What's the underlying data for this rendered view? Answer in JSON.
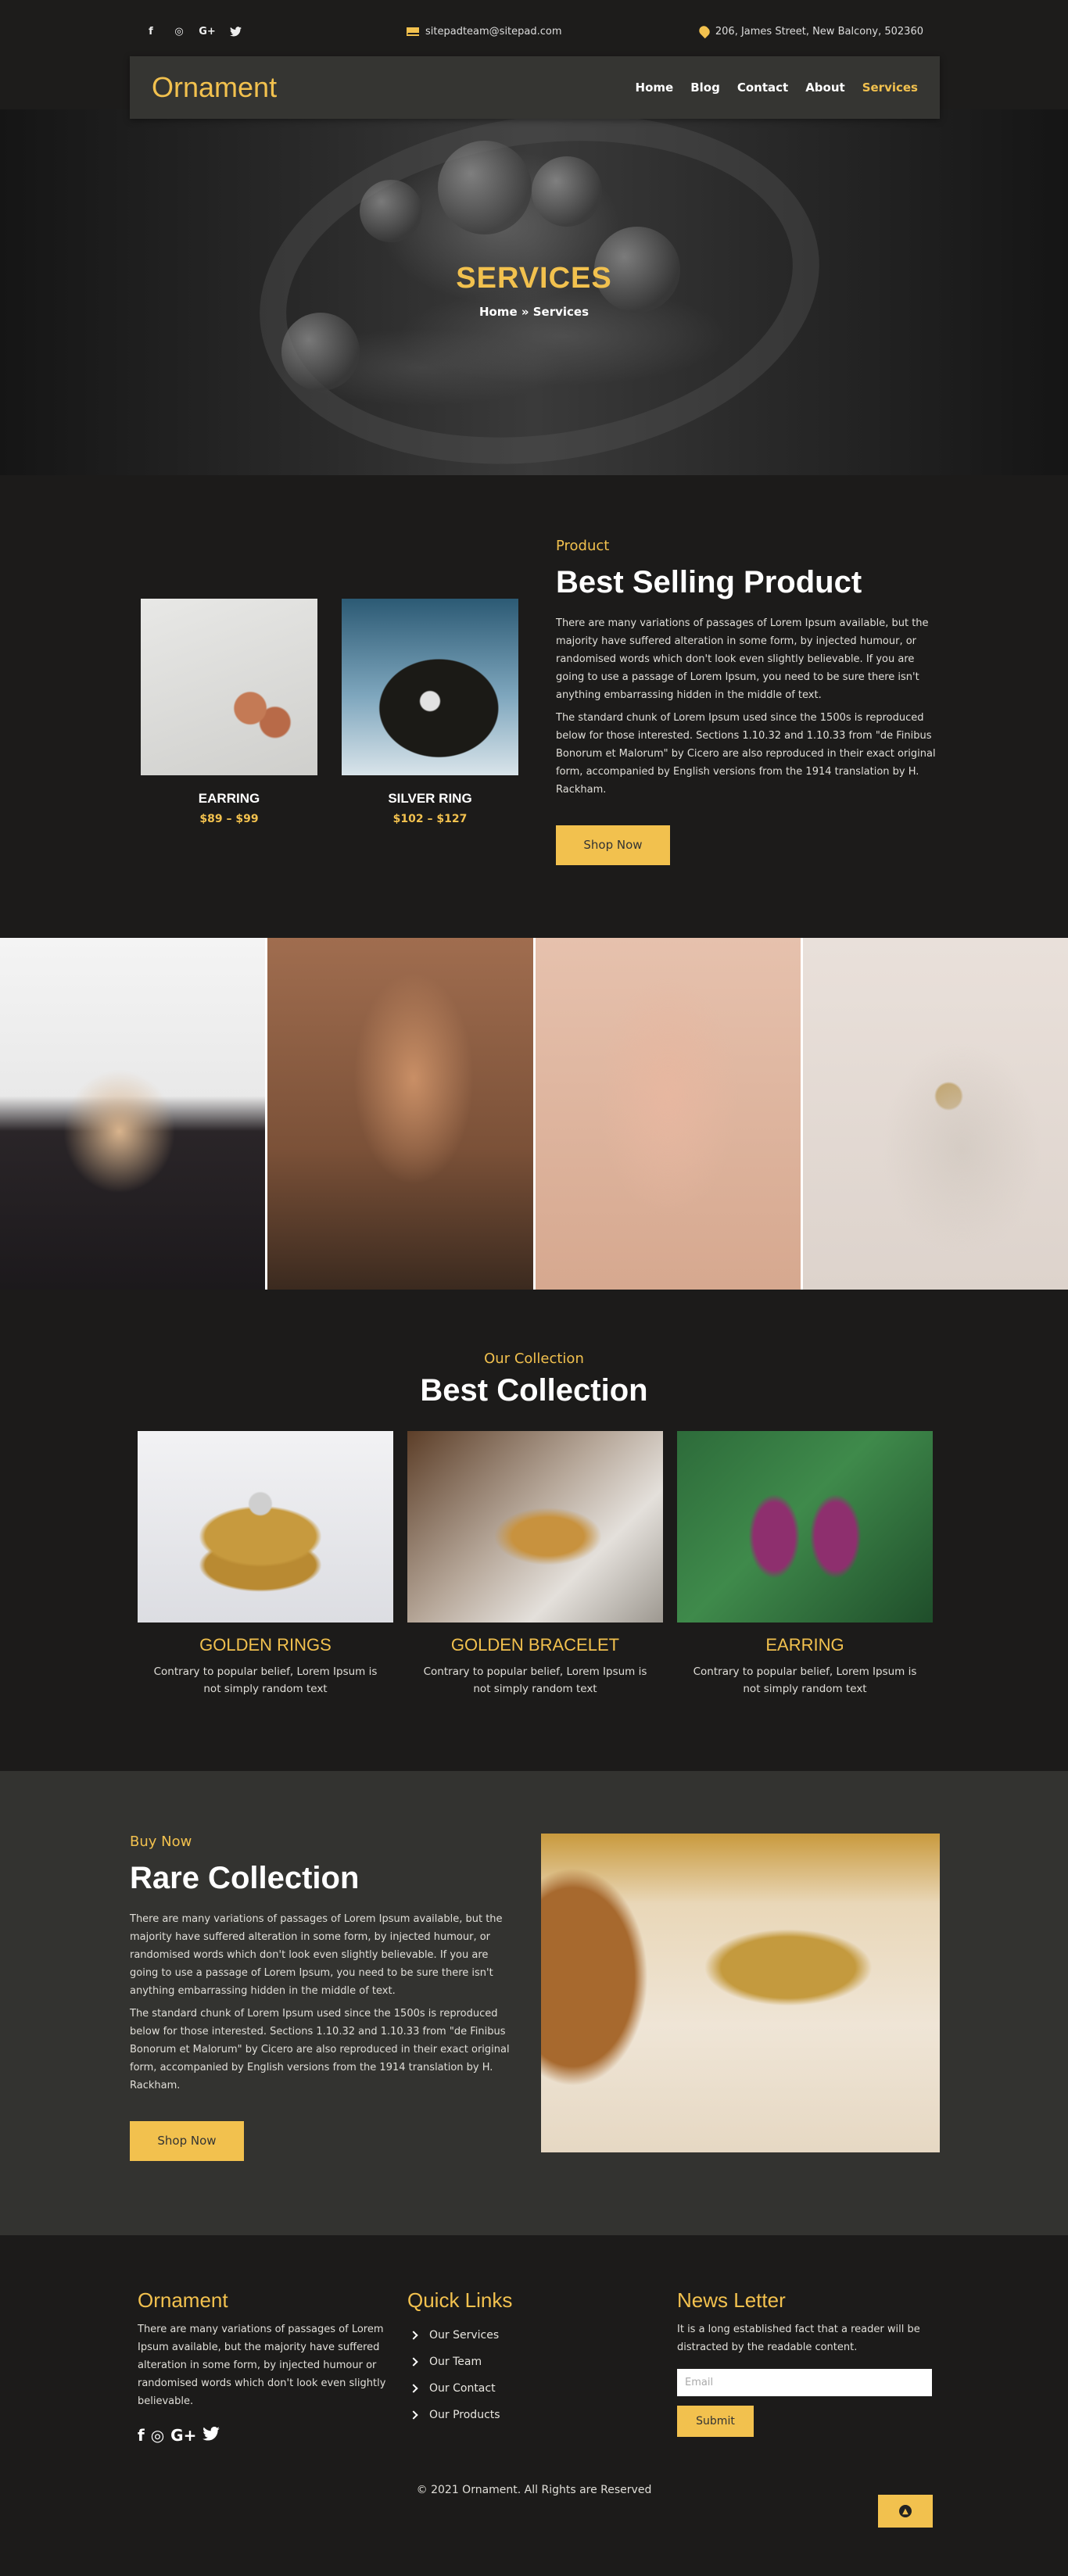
{
  "topbar": {
    "social": [
      "f",
      "◎",
      "G+",
      "🐦"
    ],
    "email": "sitepadteam@sitepad.com",
    "address": "206, James Street, New Balcony, 502360"
  },
  "nav": {
    "brand": "Ornament",
    "items": [
      "Home",
      "Blog",
      "Contact",
      "About",
      "Services"
    ],
    "active": "Services"
  },
  "hero": {
    "title": "SERVICES",
    "breadcrumb": "Home » Services"
  },
  "best_selling": {
    "eyebrow": "Product",
    "title": "Best Selling Product",
    "para1": "There are many variations of passages of Lorem Ipsum available, but the majority have suffered alteration in some form, by injected humour, or randomised words which don't look even slightly believable. If you are going to use a passage of Lorem Ipsum, you need to be sure there isn't anything embarrassing hidden in the middle of text.",
    "para2": "The standard chunk of Lorem Ipsum used since the 1500s is reproduced below for those interested. Sections 1.10.32 and 1.10.33 from \"de Finibus Bonorum et Malorum\" by Cicero are also reproduced in their exact original form, accompanied by English versions from the 1914 translation by H. Rackham.",
    "button": "Shop Now",
    "products": [
      {
        "name": "EARRING",
        "price": "$89 – $99"
      },
      {
        "name": "SILVER RING",
        "price": "$102 – $127"
      }
    ]
  },
  "collection": {
    "eyebrow": "Our Collection",
    "title": "Best Collection",
    "items": [
      {
        "name": "GOLDEN RINGS",
        "desc": "Contrary to popular belief, Lorem Ipsum is not simply random text"
      },
      {
        "name": "GOLDEN BRACELET",
        "desc": "Contrary to popular belief, Lorem Ipsum is not simply random text"
      },
      {
        "name": "EARRING",
        "desc": "Contrary to popular belief, Lorem Ipsum is not simply random text"
      }
    ]
  },
  "rare": {
    "eyebrow": "Buy Now",
    "title": "Rare Collection",
    "para1": "There are many variations of passages of Lorem Ipsum available, but the majority have suffered alteration in some form, by injected humour, or randomised words which don't look even slightly believable. If you are going to use a passage of Lorem Ipsum, you need to be sure there isn't anything embarrassing hidden in the middle of text.",
    "para2": "The standard chunk of Lorem Ipsum used since the 1500s is reproduced below for those interested. Sections 1.10.32 and 1.10.33 from \"de Finibus Bonorum et Malorum\" by Cicero are also reproduced in their exact original form, accompanied by English versions from the 1914 translation by H. Rackham.",
    "button": "Shop Now"
  },
  "footer": {
    "about_title": "Ornament",
    "about_text": "There are many variations of passages of Lorem Ipsum available, but the majority have suffered alteration in some form, by injected humour or randomised words which don't look even slightly believable.",
    "links_title": "Quick Links",
    "links": [
      "Our Services",
      "Our Team",
      "Our Contact",
      "Our Products"
    ],
    "news_title": "News Letter",
    "news_text": "It is a long established fact that a reader will be distracted by the readable content.",
    "email_placeholder": "Email",
    "submit": "Submit",
    "copyright": "© 2021 Ornament. All Rights are Reserved"
  }
}
